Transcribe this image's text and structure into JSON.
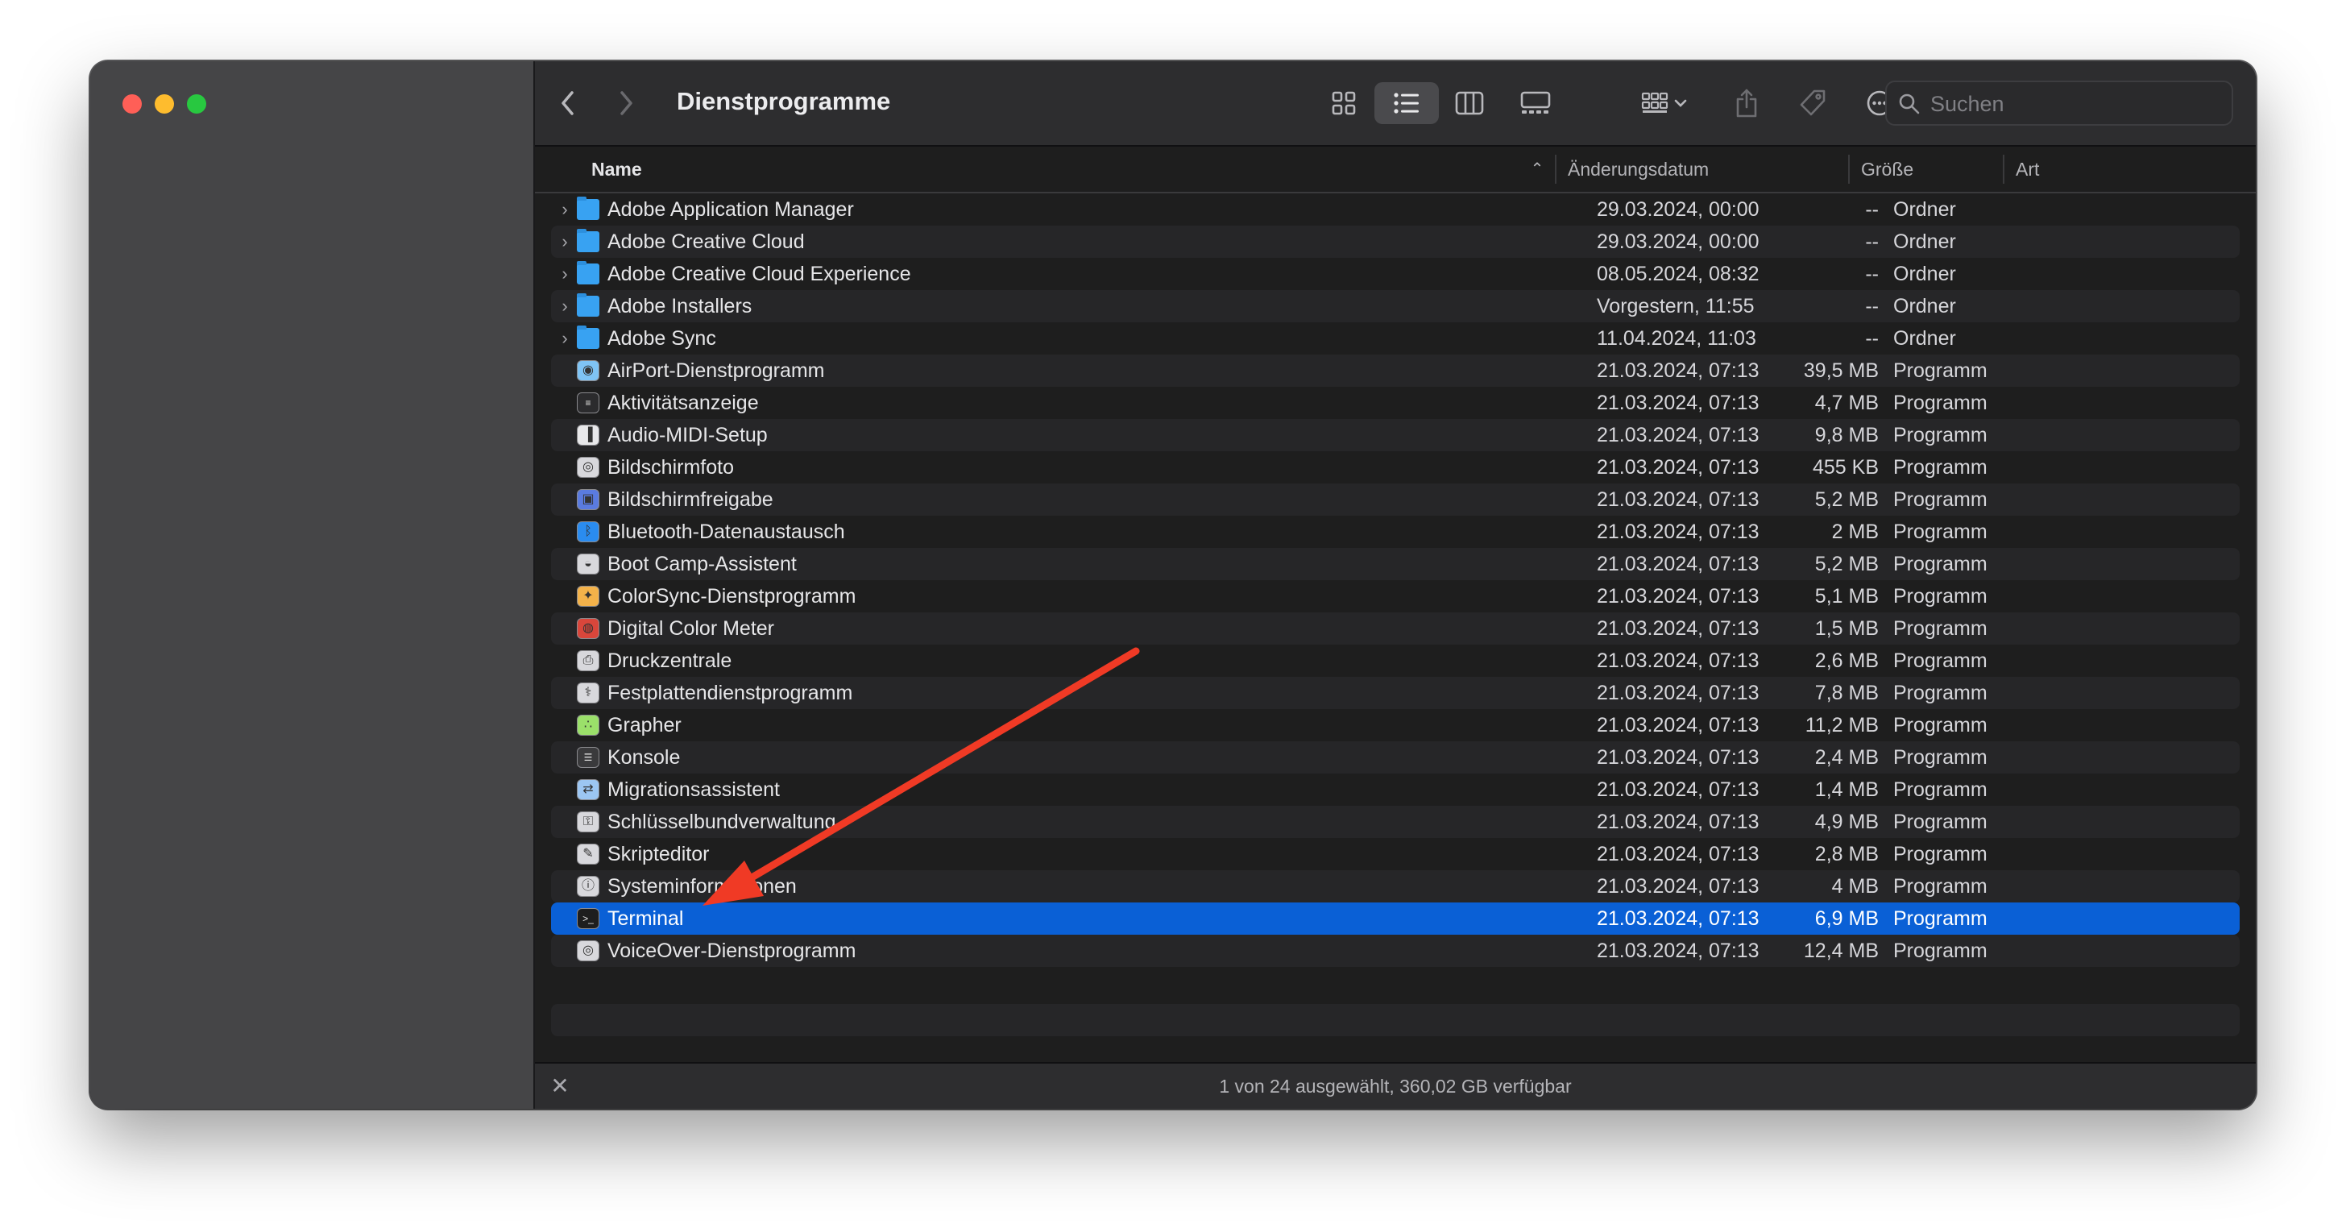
{
  "window": {
    "title": "Dienstprogramme"
  },
  "search": {
    "placeholder": "Suchen"
  },
  "columns": {
    "name": "Name",
    "date": "Änderungsdatum",
    "size": "Größe",
    "kind": "Art"
  },
  "files": [
    {
      "name": "Adobe Application Manager",
      "date": "29.03.2024, 00:00",
      "size": "--",
      "kind": "Ordner",
      "icon": "folder-icon"
    },
    {
      "name": "Adobe Creative Cloud",
      "date": "29.03.2024, 00:00",
      "size": "--",
      "kind": "Ordner",
      "icon": "folder-icon"
    },
    {
      "name": "Adobe Creative Cloud Experience",
      "date": "08.05.2024, 08:32",
      "size": "--",
      "kind": "Ordner",
      "icon": "folder-icon"
    },
    {
      "name": "Adobe Installers",
      "date": "Vorgestern, 11:55",
      "size": "--",
      "kind": "Ordner",
      "icon": "folder-icon"
    },
    {
      "name": "Adobe Sync",
      "date": "11.04.2024, 11:03",
      "size": "--",
      "kind": "Ordner",
      "icon": "folder-icon"
    },
    {
      "name": "AirPort-Dienstprogramm",
      "date": "21.03.2024, 07:13",
      "size": "39,5 MB",
      "kind": "Programm",
      "icon": "airport-icon"
    },
    {
      "name": "Aktivitätsanzeige",
      "date": "21.03.2024, 07:13",
      "size": "4,7 MB",
      "kind": "Programm",
      "icon": "activity-monitor-icon"
    },
    {
      "name": "Audio-MIDI-Setup",
      "date": "21.03.2024, 07:13",
      "size": "9,8 MB",
      "kind": "Programm",
      "icon": "midi-keyboard-icon"
    },
    {
      "name": "Bildschirmfoto",
      "date": "21.03.2024, 07:13",
      "size": "455 KB",
      "kind": "Programm",
      "icon": "screenshot-icon"
    },
    {
      "name": "Bildschirmfreigabe",
      "date": "21.03.2024, 07:13",
      "size": "5,2 MB",
      "kind": "Programm",
      "icon": "screen-sharing-icon"
    },
    {
      "name": "Bluetooth-Datenaustausch",
      "date": "21.03.2024, 07:13",
      "size": "2 MB",
      "kind": "Programm",
      "icon": "bluetooth-icon"
    },
    {
      "name": "Boot Camp-Assistent",
      "date": "21.03.2024, 07:13",
      "size": "5,2 MB",
      "kind": "Programm",
      "icon": "boot-camp-icon"
    },
    {
      "name": "ColorSync-Dienstprogramm",
      "date": "21.03.2024, 07:13",
      "size": "5,1 MB",
      "kind": "Programm",
      "icon": "colorsync-icon"
    },
    {
      "name": "Digital Color Meter",
      "date": "21.03.2024, 07:13",
      "size": "1,5 MB",
      "kind": "Programm",
      "icon": "color-meter-icon"
    },
    {
      "name": "Druckzentrale",
      "date": "21.03.2024, 07:13",
      "size": "2,6 MB",
      "kind": "Programm",
      "icon": "printer-icon"
    },
    {
      "name": "Festplattendienstprogramm",
      "date": "21.03.2024, 07:13",
      "size": "7,8 MB",
      "kind": "Programm",
      "icon": "disk-utility-icon"
    },
    {
      "name": "Grapher",
      "date": "21.03.2024, 07:13",
      "size": "11,2 MB",
      "kind": "Programm",
      "icon": "grapher-icon"
    },
    {
      "name": "Konsole",
      "date": "21.03.2024, 07:13",
      "size": "2,4 MB",
      "kind": "Programm",
      "icon": "console-icon"
    },
    {
      "name": "Migrationsassistent",
      "date": "21.03.2024, 07:13",
      "size": "1,4 MB",
      "kind": "Programm",
      "icon": "migration-icon"
    },
    {
      "name": "Schlüsselbundverwaltung",
      "date": "21.03.2024, 07:13",
      "size": "4,9 MB",
      "kind": "Programm",
      "icon": "keychain-icon"
    },
    {
      "name": "Skripteditor",
      "date": "21.03.2024, 07:13",
      "size": "2,8 MB",
      "kind": "Programm",
      "icon": "script-editor-icon"
    },
    {
      "name": "Systeminformationen",
      "date": "21.03.2024, 07:13",
      "size": "4 MB",
      "kind": "Programm",
      "icon": "system-info-icon"
    },
    {
      "name": "Terminal",
      "date": "21.03.2024, 07:13",
      "size": "6,9 MB",
      "kind": "Programm",
      "icon": "terminal-icon",
      "selected": true
    },
    {
      "name": "VoiceOver-Dienstprogramm",
      "date": "21.03.2024, 07:13",
      "size": "12,4 MB",
      "kind": "Programm",
      "icon": "voiceover-icon"
    }
  ],
  "status": {
    "text": "1 von 24 ausgewählt, 360,02 GB verfügbar"
  },
  "colors": {
    "selection": "#0a60d6",
    "annotation_arrow": "#f03a25",
    "folder": "#38a2f2"
  }
}
